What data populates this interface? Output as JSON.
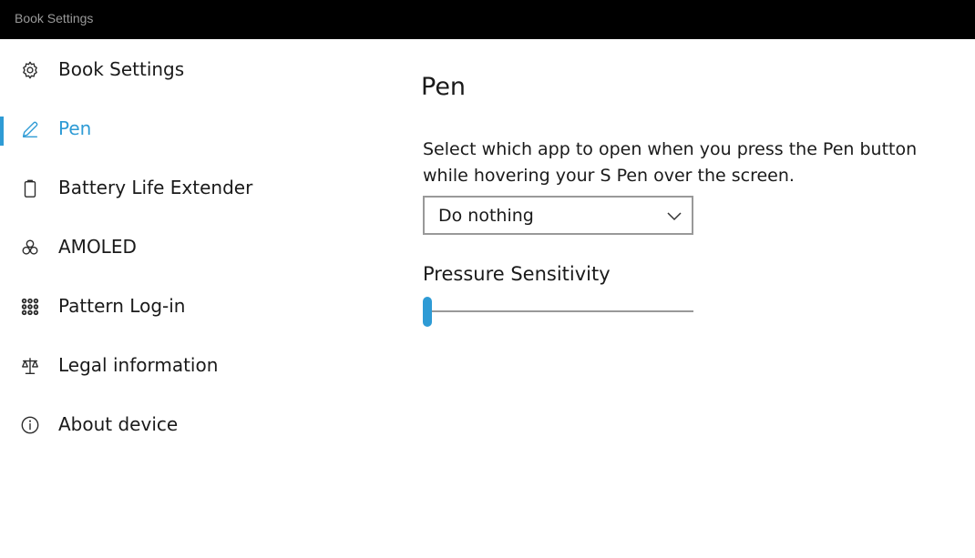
{
  "window": {
    "title": "Book Settings"
  },
  "colors": {
    "accent": "#2e9bd5",
    "titlebar": "#000000"
  },
  "sidebar": {
    "items": [
      {
        "label": "Book Settings",
        "icon": "gear-icon",
        "active": false
      },
      {
        "label": "Pen",
        "icon": "pen-icon",
        "active": true
      },
      {
        "label": "Battery Life Extender",
        "icon": "battery-icon",
        "active": false
      },
      {
        "label": "AMOLED",
        "icon": "circles-icon",
        "active": false
      },
      {
        "label": "Pattern Log-in",
        "icon": "pattern-grid-icon",
        "active": false
      },
      {
        "label": "Legal information",
        "icon": "scales-icon",
        "active": false
      },
      {
        "label": "About device",
        "icon": "info-icon",
        "active": false
      }
    ]
  },
  "main": {
    "title": "Pen",
    "description": "Select which app to open when you press the Pen button while hovering your S Pen over the screen.",
    "dropdown": {
      "value": "Do nothing"
    },
    "pressure": {
      "label": "Pressure Sensitivity",
      "value_fraction": 0.0
    }
  }
}
